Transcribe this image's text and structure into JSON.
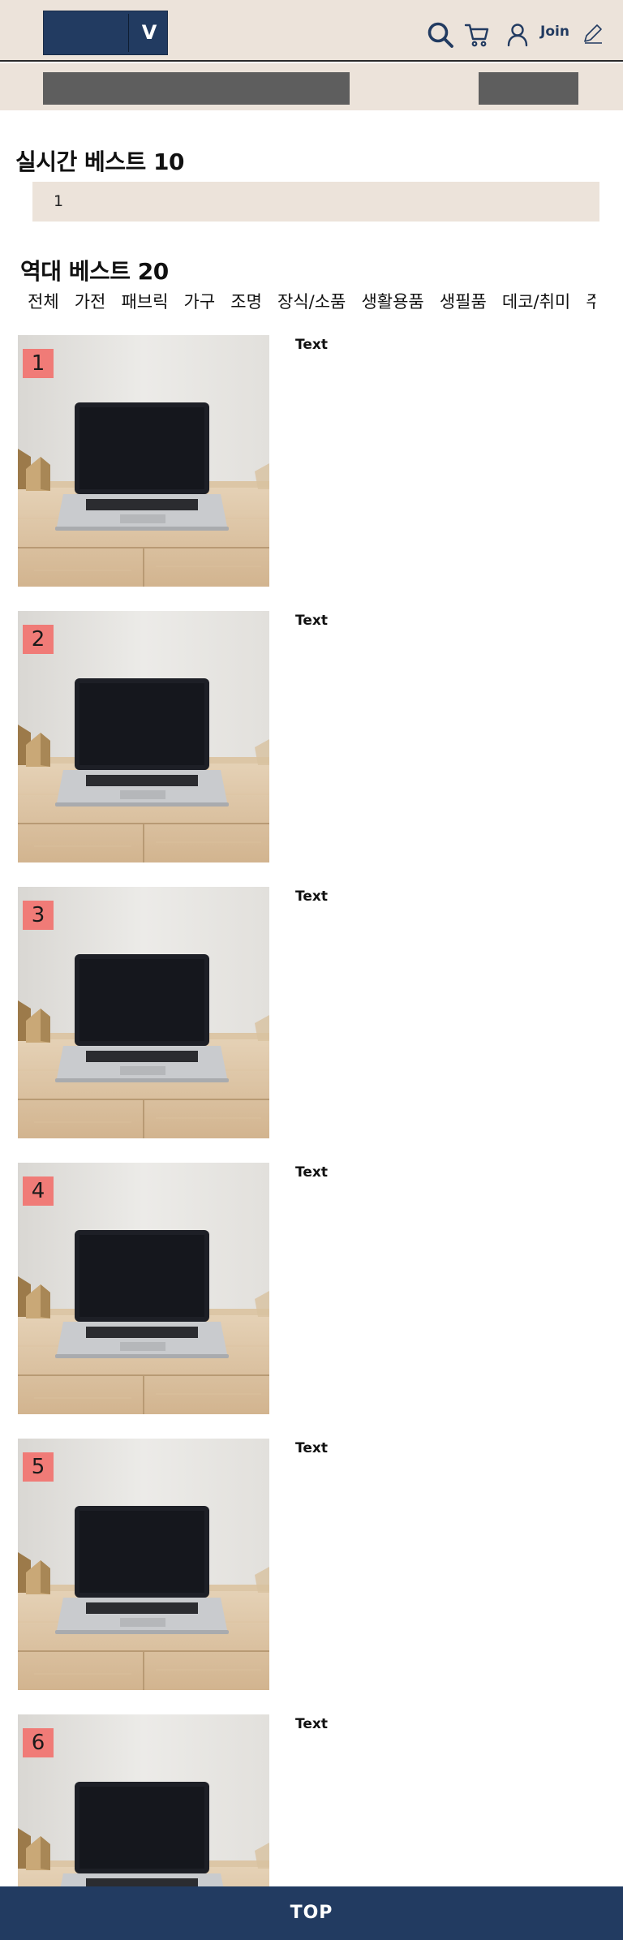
{
  "header": {
    "logo_letter": "V",
    "join_label": "Join",
    "icons": [
      "search-icon",
      "cart-icon",
      "user-icon",
      "pencil-icon"
    ]
  },
  "realtime": {
    "title": "실시간 베스트 10",
    "rank": "1"
  },
  "alltime": {
    "title": "역대 베스트 20",
    "tabs": [
      "전체",
      "가전",
      "패브릭",
      "가구",
      "조명",
      "장식/소품",
      "생활용품",
      "생필품",
      "데코/취미",
      "주"
    ]
  },
  "products": [
    {
      "rank": "1",
      "text": "Text"
    },
    {
      "rank": "2",
      "text": "Text"
    },
    {
      "rank": "3",
      "text": "Text"
    },
    {
      "rank": "4",
      "text": "Text"
    },
    {
      "rank": "5",
      "text": "Text"
    },
    {
      "rank": "6",
      "text": "Text"
    }
  ],
  "footer": {
    "top_label": "TOP"
  },
  "colors": {
    "header_bg": "#ece3da",
    "navy": "#223b61",
    "badge": "#f07b77",
    "placeholder_bar": "#5e5e5e"
  }
}
